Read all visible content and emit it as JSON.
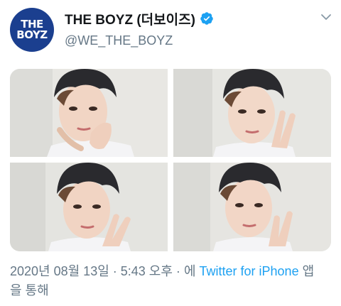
{
  "account": {
    "display_name": "THE BOYZ (더보이즈)",
    "handle": "@WE_THE_BOYZ",
    "avatar_logo": [
      "THE",
      "BOYZ"
    ],
    "verified": true
  },
  "media": {
    "photo_count": 4
  },
  "meta": {
    "timestamp": "2020년 08월 13일 · 5:43 오후 ·",
    "via_prefix": "에",
    "source_link": "Twitter for iPhone",
    "via_suffix": "앱을 통해"
  },
  "colors": {
    "brand_blue": "#1b3f8f",
    "link": "#1da1f2",
    "muted": "#657786",
    "verified": "#1da1f2"
  },
  "icons": {
    "verified": "verified-badge-icon",
    "caret": "chevron-down-icon"
  }
}
